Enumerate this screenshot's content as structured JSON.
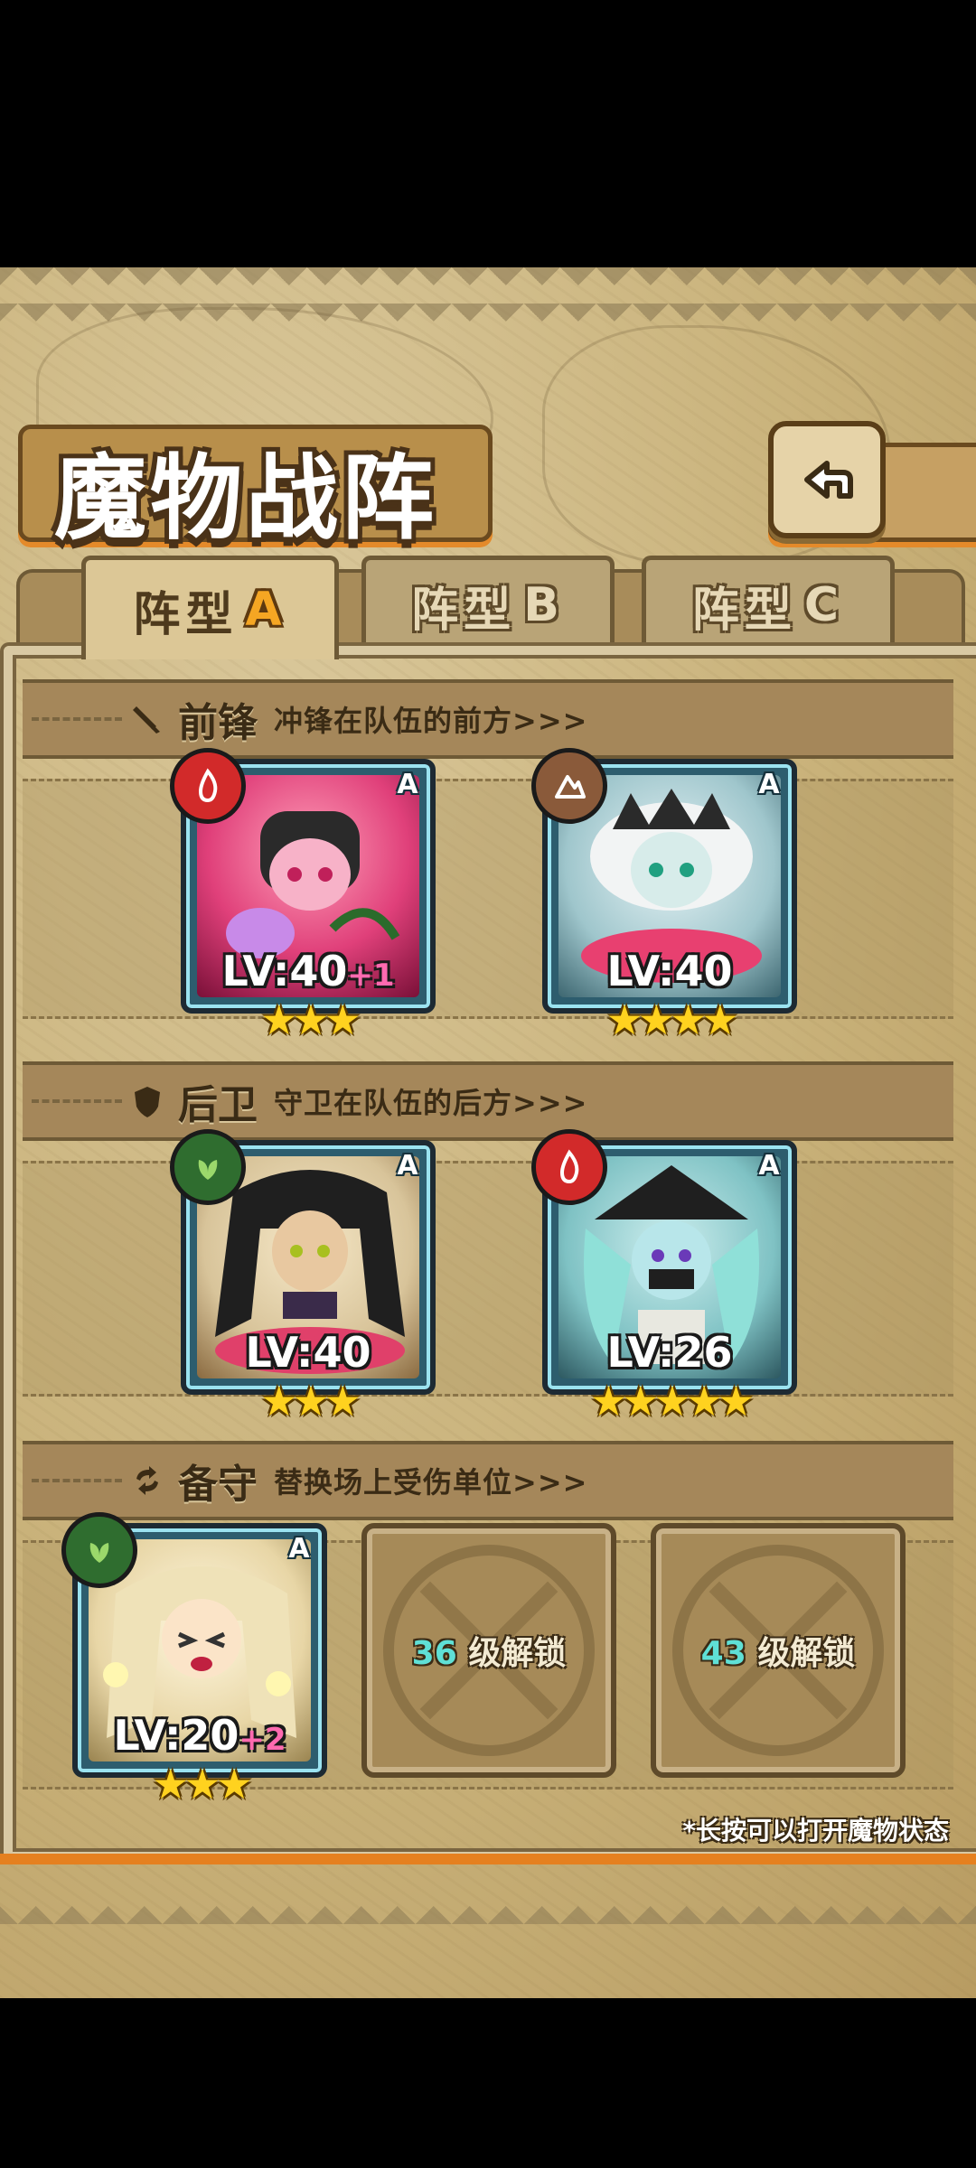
{
  "title": "魔物战阵",
  "tabs": [
    {
      "label": "阵型",
      "letter": "A",
      "active": true
    },
    {
      "label": "阵型",
      "letter": "B",
      "active": false
    },
    {
      "label": "阵型",
      "letter": "C",
      "active": false
    }
  ],
  "sections": {
    "front": {
      "title": "前锋",
      "subtitle": "冲锋在队伍的前方>>>",
      "icon": "sword-icon"
    },
    "rear": {
      "title": "后卫",
      "subtitle": "守卫在队伍的后方>>>",
      "icon": "shield-icon"
    },
    "reserve": {
      "title": "备守",
      "subtitle": "替换场上受伤单位>>>",
      "icon": "swap-icon"
    }
  },
  "cards": {
    "front1": {
      "rank": "A",
      "level": "LV:40",
      "bonus": "+1",
      "stars": "★★★",
      "element": "fire"
    },
    "front2": {
      "rank": "A",
      "level": "LV:40",
      "bonus": "",
      "stars": "★★★★",
      "element": "earth"
    },
    "rear1": {
      "rank": "A",
      "level": "LV:40",
      "bonus": "",
      "stars": "★★★",
      "element": "nature"
    },
    "rear2": {
      "rank": "A",
      "level": "LV:26",
      "bonus": "",
      "stars": "★★★★★",
      "element": "fire"
    },
    "reserve1": {
      "rank": "A",
      "level": "LV:20",
      "bonus": "+2",
      "stars": "★★★",
      "element": "nature"
    }
  },
  "locked_slots": [
    {
      "level": "36",
      "label": "级解锁"
    },
    {
      "level": "43",
      "label": "级解锁"
    }
  ],
  "hint": "*长按可以打开魔物状态",
  "colors": {
    "fire": "#d22a2a",
    "earth": "#8a5a3a",
    "nature": "#2f6d2f",
    "accent": "#e5801f"
  }
}
